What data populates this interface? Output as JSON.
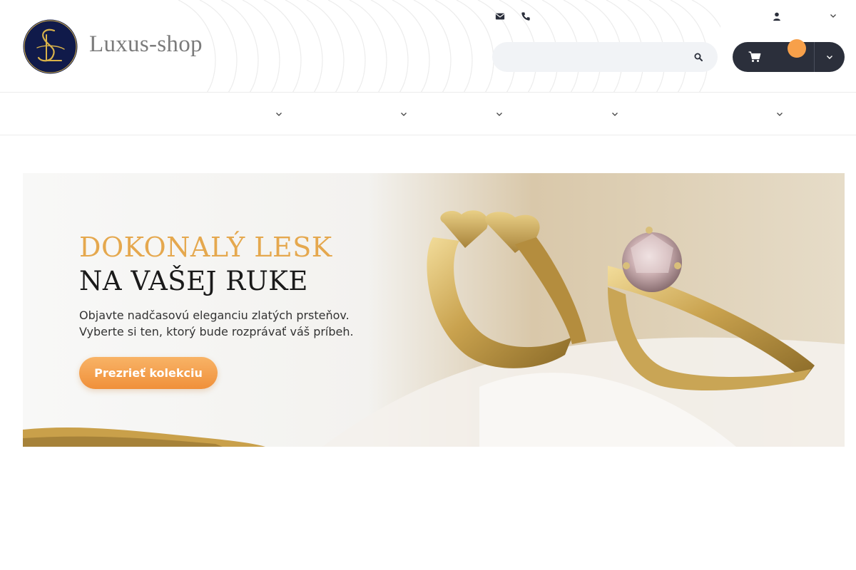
{
  "brand": {
    "name": "Luxus-shop",
    "logo_letters": "LS"
  },
  "header": {
    "contact_icons": [
      "mail-icon",
      "phone-icon"
    ],
    "user_icon": "user-icon",
    "search": {
      "value": "",
      "placeholder": "",
      "icon": "search-icon"
    },
    "cart": {
      "icon": "cart-icon",
      "badge": "",
      "toggle_icon": "chevron-down-icon"
    }
  },
  "nav": {
    "items": [
      {
        "label": "",
        "icon": "chevron-down-icon"
      },
      {
        "label": "",
        "icon": "chevron-down-icon"
      },
      {
        "label": "",
        "icon": "chevron-down-icon"
      },
      {
        "label": "",
        "icon": "chevron-down-icon"
      },
      {
        "label": "",
        "icon": "chevron-down-icon"
      }
    ]
  },
  "banner": {
    "title_line1": "DOKONALÝ LESK",
    "title_line2": "NA VAŠEJ RUKE",
    "subtitle_line1": "Objavte nadčasovú eleganciu zlatých prsteňov.",
    "subtitle_line2": "Vyberte si ten, ktorý bude rozprávať váš príbeh.",
    "cta": "Prezrieť kolekciu"
  },
  "colors": {
    "accent": "#f7a04a",
    "dark": "#2b2f3b",
    "logo_bg": "#101a4a",
    "logo_gold": "#d8b24a",
    "title_gold": "#e5a84e"
  }
}
